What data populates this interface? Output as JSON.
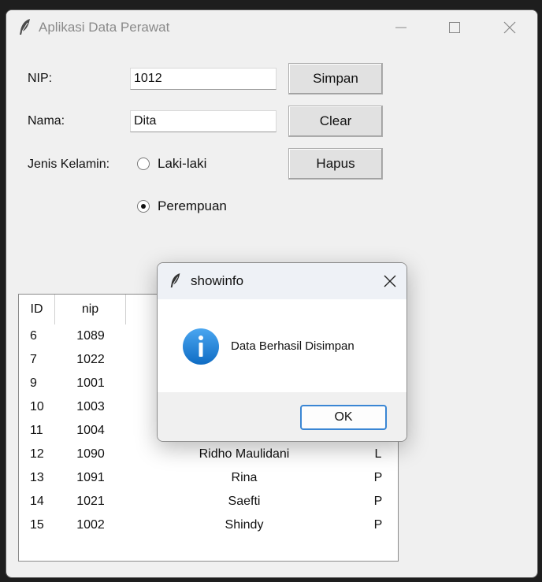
{
  "window": {
    "title": "Aplikasi Data Perawat"
  },
  "form": {
    "nip_label": "NIP:",
    "nip_value": "1012",
    "nama_label": "Nama:",
    "nama_value": "Dita",
    "gender_label": "Jenis Kelamin:",
    "gender_options": [
      {
        "label": "Laki-laki",
        "checked": false
      },
      {
        "label": "Perempuan",
        "checked": true
      }
    ]
  },
  "buttons": {
    "simpan": "Simpan",
    "clear": "Clear",
    "hapus": "Hapus"
  },
  "table": {
    "columns": [
      "ID",
      "nip"
    ],
    "rows": [
      {
        "id": "6",
        "nip": "1089",
        "nama": "",
        "jk": ""
      },
      {
        "id": "7",
        "nip": "1022",
        "nama": "",
        "jk": ""
      },
      {
        "id": "9",
        "nip": "1001",
        "nama": "",
        "jk": ""
      },
      {
        "id": "10",
        "nip": "1003",
        "nama": "",
        "jk": ""
      },
      {
        "id": "11",
        "nip": "1004",
        "nama": "",
        "jk": ""
      },
      {
        "id": "12",
        "nip": "1090",
        "nama": "Ridho Maulidani",
        "jk": "L"
      },
      {
        "id": "13",
        "nip": "1091",
        "nama": "Rina",
        "jk": "P"
      },
      {
        "id": "14",
        "nip": "1021",
        "nama": "Saefti",
        "jk": "P"
      },
      {
        "id": "15",
        "nip": "1002",
        "nama": "Shindy",
        "jk": "P"
      }
    ]
  },
  "dialog": {
    "title": "showinfo",
    "message": "Data Berhasil Disimpan",
    "ok_label": "OK",
    "icon": "info-icon"
  },
  "colors": {
    "accent": "#3a86d4",
    "info": "#1e7fd8"
  }
}
